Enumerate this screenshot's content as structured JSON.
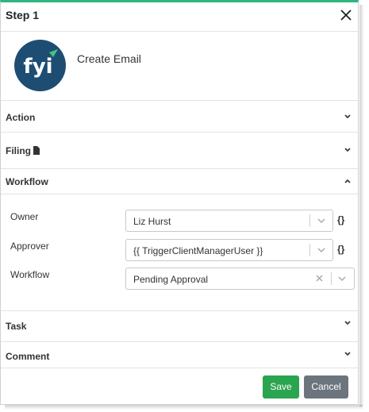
{
  "dialog": {
    "title": "Step 1",
    "close_icon": "close-icon",
    "header_accent_color": "#2fb57f"
  },
  "template": {
    "logo_icon": "fyi-logo-icon",
    "logo_text": "fyi",
    "logo_bg_color": "#1e4d73",
    "name": "Create Email"
  },
  "sections": {
    "action": {
      "label": "Action",
      "expanded": false
    },
    "filing": {
      "label": "Filing",
      "icon": "file-icon",
      "expanded": false
    },
    "workflow": {
      "label": "Workflow",
      "expanded": true
    },
    "task": {
      "label": "Task",
      "expanded": false
    },
    "comment": {
      "label": "Comment",
      "expanded": false
    }
  },
  "workflow_fields": {
    "owner": {
      "label": "Owner",
      "value": "Liz Hurst",
      "variable_icon": "{}"
    },
    "approver": {
      "label": "Approver",
      "value": "{{ TriggerClientManagerUser }}",
      "variable_icon": "{}"
    },
    "workflow": {
      "label": "Workflow",
      "value": "Pending Approval"
    }
  },
  "footer": {
    "save_label": "Save",
    "save_color": "#2aa44f",
    "cancel_label": "Cancel",
    "cancel_color": "#6c757d"
  }
}
